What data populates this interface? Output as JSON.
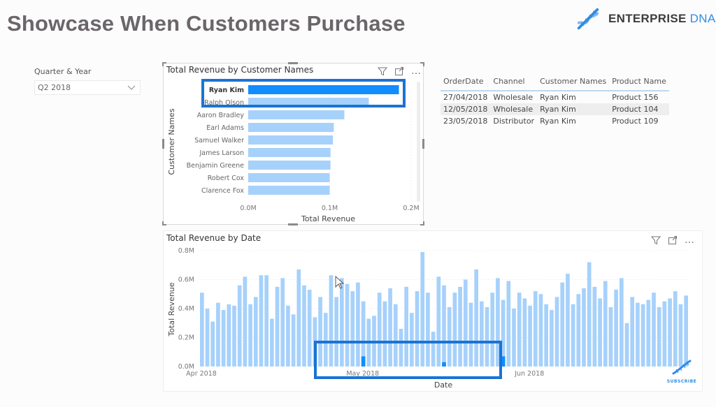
{
  "page": {
    "title": "Showcase When Customers Purchase"
  },
  "logo": {
    "icon": "dna-icon",
    "text_main": "ENTERPRISE",
    "text_accent": "DNA",
    "accent_color": "#2f8de4"
  },
  "slicer": {
    "label": "Quarter & Year",
    "selected": "Q2 2018",
    "icon": "chevron-down-icon"
  },
  "visual_icons": {
    "filter": "filter-icon",
    "focus": "focus-mode-icon",
    "more": "more-options-icon",
    "more_label": "…"
  },
  "table": {
    "columns": [
      "OrderDate",
      "Channel",
      "Customer Names",
      "Product Name"
    ],
    "rows": [
      [
        "27/04/2018",
        "Wholesale",
        "Ryan Kim",
        "Product 156"
      ],
      [
        "12/05/2018",
        "Wholesale",
        "Ryan Kim",
        "Product 104"
      ],
      [
        "23/05/2018",
        "Distributor",
        "Ryan Kim",
        "Product 109"
      ]
    ]
  },
  "subscribe": {
    "label": "SUBSCRIBE"
  },
  "colors": {
    "bar_default": "#a6d1fb",
    "bar_selected": "#118dff",
    "highlight_box": "#1a74d2"
  },
  "chart_data": [
    {
      "type": "bar",
      "orientation": "horizontal",
      "title": "Total Revenue by Customer Names",
      "xlabel": "Total Revenue",
      "ylabel": "Customer Names",
      "categories": [
        "Ryan Kim",
        "Ralph Olson",
        "Aaron Bradley",
        "Earl Adams",
        "Samuel Walker",
        "James Larson",
        "Benjamin Greene",
        "Robert Cox",
        "Clarence Fox"
      ],
      "values": [
        0.185,
        0.148,
        0.118,
        0.105,
        0.104,
        0.101,
        0.101,
        0.1,
        0.1
      ],
      "unit": "M",
      "selected": "Ryan Kim",
      "xlim": [
        0,
        0.2
      ],
      "xticks": [
        "0.0M",
        "0.1M",
        "0.2M"
      ],
      "grid": true,
      "legend": "none"
    },
    {
      "type": "bar",
      "orientation": "vertical",
      "title": "Total Revenue by Date",
      "xlabel": "Date",
      "ylabel": "Total Revenue",
      "unit": "M",
      "ylim": [
        0,
        0.8
      ],
      "yticks": [
        "0.0M",
        "0.2M",
        "0.4M",
        "0.6M",
        "0.8M"
      ],
      "x_tick_labels": [
        {
          "label": "Apr 2018",
          "index": 0
        },
        {
          "label": "May 2018",
          "index": 30
        },
        {
          "label": "Jun 2018",
          "index": 61
        }
      ],
      "grid": true,
      "legend": "none",
      "values": [
        0.51,
        0.4,
        0.31,
        0.44,
        0.39,
        0.43,
        0.42,
        0.56,
        0.62,
        0.43,
        0.48,
        0.63,
        0.63,
        0.33,
        0.55,
        0.61,
        0.42,
        0.36,
        0.67,
        0.56,
        0.53,
        0.34,
        0.48,
        0.37,
        0.63,
        0.48,
        0.61,
        0.57,
        0.52,
        0.58,
        0.45,
        0.33,
        0.35,
        0.51,
        0.45,
        0.54,
        0.43,
        0.26,
        0.55,
        0.37,
        0.52,
        0.79,
        0.51,
        0.24,
        0.62,
        0.56,
        0.41,
        0.51,
        0.55,
        0.6,
        0.44,
        0.67,
        0.45,
        0.41,
        0.51,
        0.61,
        0.46,
        0.59,
        0.4,
        0.51,
        0.47,
        0.42,
        0.52,
        0.5,
        0.43,
        0.39,
        0.48,
        0.58,
        0.64,
        0.43,
        0.5,
        0.54,
        0.72,
        0.55,
        0.47,
        0.59,
        0.41,
        0.53,
        0.61,
        0.3,
        0.48,
        0.44,
        0.43,
        0.46,
        0.51,
        0.41,
        0.45,
        0.47,
        0.52,
        0.43,
        0.49
      ],
      "selected_values": [
        {
          "index": 30,
          "value": 0.07
        },
        {
          "index": 45,
          "value": 0.03
        },
        {
          "index": 56,
          "value": 0.07
        }
      ]
    }
  ]
}
